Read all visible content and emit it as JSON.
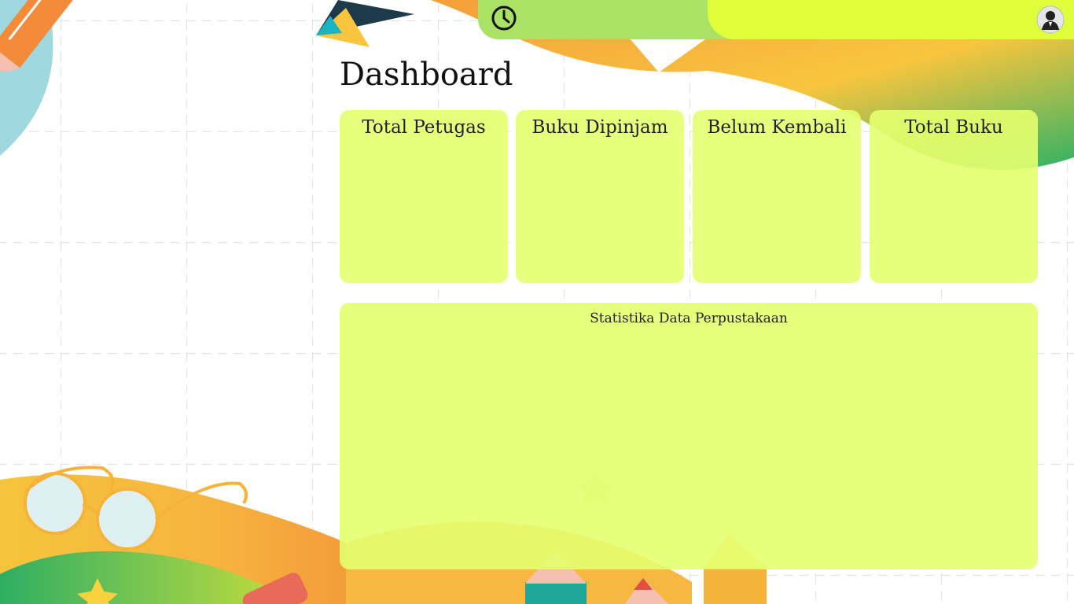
{
  "header": {
    "clock_icon": "clock-icon",
    "avatar_icon": "user-avatar-icon",
    "colors": {
      "left": "#a9e264",
      "right": "#e0ff3a"
    }
  },
  "page": {
    "title": "Dashboard"
  },
  "cards": [
    {
      "label": "Total Petugas"
    },
    {
      "label": "Buku Dipinjam"
    },
    {
      "label": "Belum Kembali"
    },
    {
      "label": "Total Buku"
    }
  ],
  "stats": {
    "title": "Statistika Data Perpustakaan"
  },
  "theme": {
    "card_bg": "#e4ff6e",
    "accent_orange": "#f3a03f",
    "accent_green": "#37b565"
  }
}
